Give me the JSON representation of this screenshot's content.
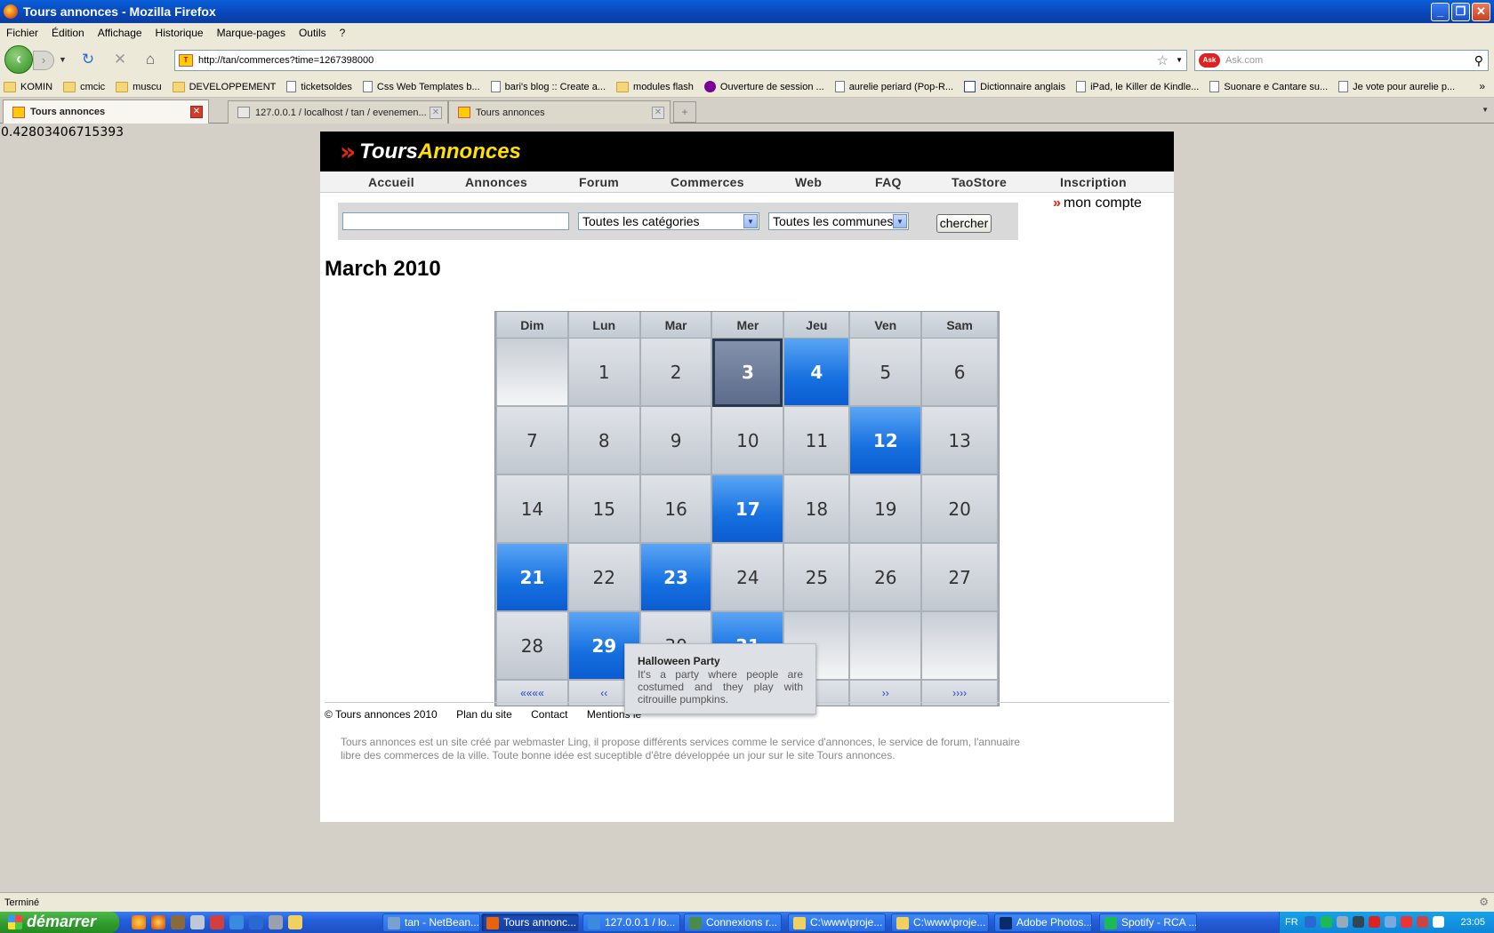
{
  "window": {
    "title": "Tours annonces - Mozilla Firefox"
  },
  "menu": [
    "Fichier",
    "Édition",
    "Affichage",
    "Historique",
    "Marque-pages",
    "Outils",
    "?"
  ],
  "url": "http://tan/commerces?time=1267398000",
  "search_placeholder": "Ask.com",
  "bookmarks": [
    {
      "label": "KOMIN",
      "icon": "folder"
    },
    {
      "label": "cmcic",
      "icon": "folder"
    },
    {
      "label": "muscu",
      "icon": "folder"
    },
    {
      "label": "DEVELOPPEMENT",
      "icon": "folder"
    },
    {
      "label": "ticketsoldes",
      "icon": "page"
    },
    {
      "label": "Css Web Templates b...",
      "icon": "page"
    },
    {
      "label": "bari's blog :: Create a...",
      "icon": "page"
    },
    {
      "label": "modules flash",
      "icon": "folder"
    },
    {
      "label": "Ouverture de session ...",
      "icon": "yahoo"
    },
    {
      "label": "aurelie periard (Pop-R...",
      "icon": "page"
    },
    {
      "label": "Dictionnaire anglais",
      "icon": "wr"
    },
    {
      "label": "iPad, le Killer de Kindle...",
      "icon": "page"
    },
    {
      "label": "Suonare e Cantare su...",
      "icon": "page"
    },
    {
      "label": "Je vote pour aurelie p...",
      "icon": "page"
    }
  ],
  "tabs": [
    {
      "label": "Tours annonces",
      "active": true
    },
    {
      "label": "127.0.0.1 / localhost / tan / evenemen...",
      "active": false
    },
    {
      "label": "Tours annonces",
      "active": false
    }
  ],
  "random_number": "0.42803406715393",
  "site": {
    "logo_part1": "Tours",
    "logo_part2": "Annonces",
    "nav": [
      "Accueil",
      "Annonces",
      "Forum",
      "Commerces",
      "Web",
      "FAQ",
      "TaoStore",
      "Inscription"
    ],
    "category_select": "Toutes les catégories",
    "commune_select": "Toutes les communes",
    "search_button": "chercher",
    "account_link": "mon compte"
  },
  "calendar": {
    "title": "March 2010",
    "weekdays": [
      "Dim",
      "Lun",
      "Mar",
      "Mer",
      "Jeu",
      "Ven",
      "Sam"
    ],
    "weeks": [
      [
        {
          "d": ""
        },
        {
          "d": "1"
        },
        {
          "d": "2"
        },
        {
          "d": "3",
          "s": "today"
        },
        {
          "d": "4",
          "s": "ev"
        },
        {
          "d": "5"
        },
        {
          "d": "6"
        }
      ],
      [
        {
          "d": "7"
        },
        {
          "d": "8"
        },
        {
          "d": "9"
        },
        {
          "d": "10"
        },
        {
          "d": "11"
        },
        {
          "d": "12",
          "s": "ev"
        },
        {
          "d": "13"
        }
      ],
      [
        {
          "d": "14"
        },
        {
          "d": "15"
        },
        {
          "d": "16"
        },
        {
          "d": "17",
          "s": "ev"
        },
        {
          "d": "18"
        },
        {
          "d": "19"
        },
        {
          "d": "20"
        }
      ],
      [
        {
          "d": "21",
          "s": "ev"
        },
        {
          "d": "22"
        },
        {
          "d": "23",
          "s": "ev"
        },
        {
          "d": "24"
        },
        {
          "d": "25"
        },
        {
          "d": "26"
        },
        {
          "d": "27"
        }
      ],
      [
        {
          "d": "28"
        },
        {
          "d": "29",
          "s": "ev"
        },
        {
          "d": "30"
        },
        {
          "d": "31",
          "s": "ev"
        },
        {
          "d": ""
        },
        {
          "d": ""
        },
        {
          "d": ""
        }
      ]
    ],
    "nav": {
      "prev_year": "««««",
      "prev_month": "‹‹",
      "next_month": "››",
      "next_year": "››››"
    },
    "tooltip": {
      "title": "Halloween Party",
      "text": "It's a party where people are costumed and they play with citrouille pumpkins."
    }
  },
  "footer": {
    "copyright": "© Tours annonces 2010",
    "links": [
      "Plan du site",
      "Contact",
      "Mentions le"
    ],
    "description": "Tours annonces est un site créé par webmaster Ling, il propose différents services comme le service d'annonces, le service de forum, l'annuaire libre des commerces de la ville. Toute bonne idée est suceptible d'être développée un jour sur le site Tours annonces."
  },
  "status": "Terminé",
  "taskbar": {
    "start": "démarrer",
    "tasks": [
      {
        "label": "tan - NetBean..."
      },
      {
        "label": "Tours annonc...",
        "active": true
      },
      {
        "label": "127.0.0.1 / lo..."
      },
      {
        "label": "Connexions r..."
      },
      {
        "label": "C:\\www\\proje..."
      },
      {
        "label": "C:\\www\\proje..."
      },
      {
        "label": "Adobe Photos..."
      },
      {
        "label": "Spotify - RCA ..."
      }
    ],
    "lang": "FR",
    "clock": "23:05"
  },
  "colors": {
    "brand_red": "#e1261c",
    "brand_yellow": "#ffe100",
    "event_blue": "#1670e0"
  }
}
